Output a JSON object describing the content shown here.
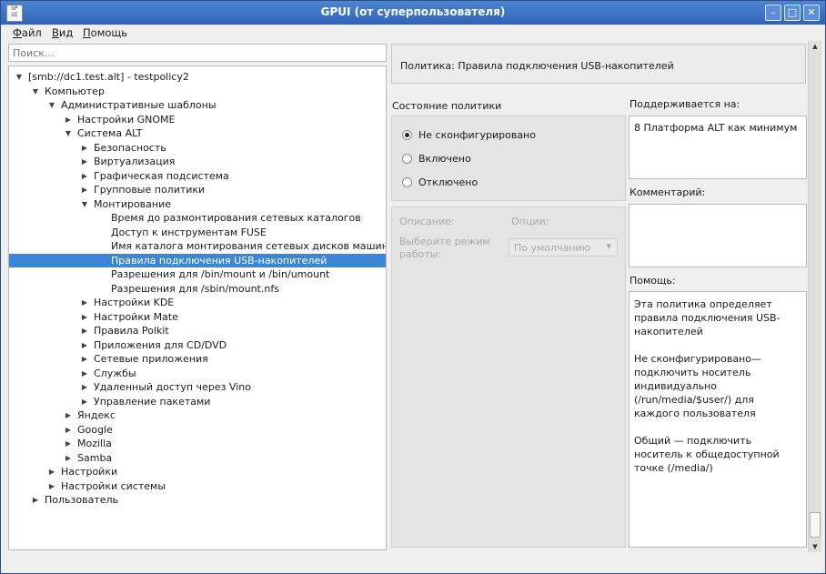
{
  "window": {
    "title": "GPUI (от суперпользователя)",
    "icon_text": "GP UI"
  },
  "menu": [
    {
      "label": "Файл",
      "mnemonic": "Ф",
      "rest": "айл"
    },
    {
      "label": "Вид",
      "mnemonic": "В",
      "rest": "ид"
    },
    {
      "label": "Помощь",
      "mnemonic": "П",
      "rest": "омощь"
    }
  ],
  "search": {
    "placeholder": "Поиск..."
  },
  "tree": [
    {
      "label": "[smb://dc1.test.alt] - testpolicy2",
      "level": 0,
      "state": "expanded"
    },
    {
      "label": "Компьютер",
      "level": 1,
      "state": "expanded"
    },
    {
      "label": "Административные шаблоны",
      "level": 2,
      "state": "expanded"
    },
    {
      "label": "Настройки GNOME",
      "level": 3,
      "state": "collapsed"
    },
    {
      "label": "Система ALT",
      "level": 3,
      "state": "expanded"
    },
    {
      "label": "Безопасность",
      "level": 4,
      "state": "collapsed"
    },
    {
      "label": "Виртуализация",
      "level": 4,
      "state": "collapsed"
    },
    {
      "label": "Графическая подсистема",
      "level": 4,
      "state": "collapsed"
    },
    {
      "label": "Групповые политики",
      "level": 4,
      "state": "collapsed"
    },
    {
      "label": "Монтирование",
      "level": 4,
      "state": "expanded"
    },
    {
      "label": "Время до размонтирования сетевых каталогов",
      "level": 5,
      "state": "leaf"
    },
    {
      "label": "Доступ к инструментам FUSE",
      "level": 5,
      "state": "leaf"
    },
    {
      "label": "Имя каталога монтирования сетевых дисков машины",
      "level": 5,
      "state": "leaf"
    },
    {
      "label": "Правила подключения USB-накопителей",
      "level": 5,
      "state": "leaf",
      "selected": true
    },
    {
      "label": "Разрешения для /bin/mount и /bin/umount",
      "level": 5,
      "state": "leaf"
    },
    {
      "label": "Разрешения для /sbin/mount.nfs",
      "level": 5,
      "state": "leaf"
    },
    {
      "label": "Настройки KDE",
      "level": 4,
      "state": "collapsed"
    },
    {
      "label": "Настройки Mate",
      "level": 4,
      "state": "collapsed"
    },
    {
      "label": "Правила Polkit",
      "level": 4,
      "state": "collapsed"
    },
    {
      "label": "Приложения для CD/DVD",
      "level": 4,
      "state": "collapsed"
    },
    {
      "label": "Сетевые приложения",
      "level": 4,
      "state": "collapsed"
    },
    {
      "label": "Службы",
      "level": 4,
      "state": "collapsed"
    },
    {
      "label": "Удаленный доступ через Vino",
      "level": 4,
      "state": "collapsed"
    },
    {
      "label": "Управление пакетами",
      "level": 4,
      "state": "collapsed"
    },
    {
      "label": "Яндекс",
      "level": 3,
      "state": "collapsed"
    },
    {
      "label": "Google",
      "level": 3,
      "state": "collapsed"
    },
    {
      "label": "Mozilla",
      "level": 3,
      "state": "collapsed"
    },
    {
      "label": "Samba",
      "level": 3,
      "state": "collapsed"
    },
    {
      "label": "Настройки",
      "level": 2,
      "state": "collapsed"
    },
    {
      "label": "Настройки системы",
      "level": 2,
      "state": "collapsed"
    },
    {
      "label": "Пользователь",
      "level": 1,
      "state": "collapsed"
    }
  ],
  "policy": {
    "header": "Политика: Правила подключения USB-накопителей",
    "state_label": "Состояние политики",
    "options": [
      {
        "label": "Не сконфигурировано",
        "checked": true
      },
      {
        "label": "Включено",
        "checked": false
      },
      {
        "label": "Отключено",
        "checked": false
      }
    ],
    "description_label": "Описание:",
    "options_label": "Опции:",
    "mode_label": "Выберите режим работы:",
    "mode_value": "По умолчанию",
    "supported_label": "Поддерживается на:",
    "supported_value": "8 Платформа ALT как минимум",
    "comment_label": "Комментарий:",
    "comment_value": "",
    "help_label": "Помощь:",
    "help_paragraphs": [
      "Эта политика определяет правила подключения USB-накопителей",
      "Не сконфигурировано— подключить носитель индивидуально (/run/media/$user/) для каждого пользователя",
      "Общий — подключить носитель к общедоступной точке (/media/)"
    ]
  },
  "colors": {
    "titlebar": "#2f64b4",
    "selection": "#3b86d8"
  }
}
